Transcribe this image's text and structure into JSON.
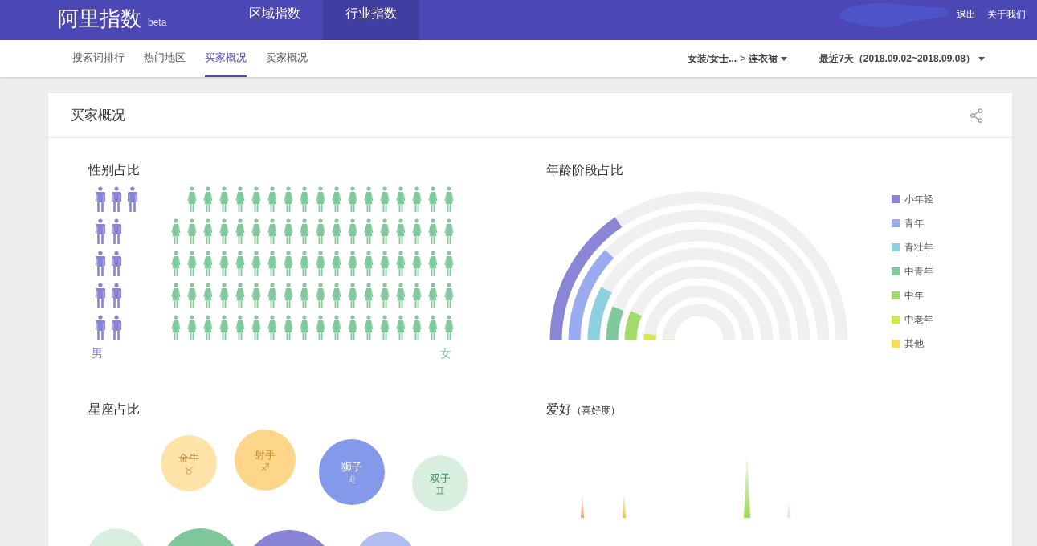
{
  "header": {
    "logo": "阿里指数",
    "badge": "beta",
    "tabs": [
      {
        "label": "区域指数",
        "selected": false
      },
      {
        "label": "行业指数",
        "selected": true
      }
    ],
    "links": [
      "退出",
      "关于我们"
    ]
  },
  "subnav": {
    "tabs": [
      {
        "label": "搜索词排行",
        "selected": false
      },
      {
        "label": "热门地区",
        "selected": false
      },
      {
        "label": "买家概况",
        "selected": true
      },
      {
        "label": "卖家概况",
        "selected": false
      }
    ],
    "category": {
      "parent": "女装/女士...",
      "separator": ">",
      "current": "连衣裙"
    },
    "date_range": "最近7天（2018.09.02~2018.09.08）"
  },
  "card": {
    "title": "买家概况",
    "gender": {
      "title": "性别占比",
      "male_label": "男",
      "female_label": "女",
      "level": 0.11
    },
    "age": {
      "title": "年龄阶段占比",
      "groups": [
        {
          "label": "小年轻",
          "color": "#8985d7"
        },
        {
          "label": "青年",
          "color": "#9aabef"
        },
        {
          "label": "青壮年",
          "color": "#8dd0df"
        },
        {
          "label": "中青年",
          "color": "#80c99c"
        },
        {
          "label": "中年",
          "color": "#a3dc6c"
        },
        {
          "label": "中老年",
          "color": "#d3e84f"
        },
        {
          "label": "其他",
          "color": "#f7dc55"
        }
      ]
    },
    "constellation": {
      "title": "星座占比",
      "bubbles": [
        {
          "label": "金牛",
          "symbol": "♉",
          "color": "#fde3a8"
        },
        {
          "label": "射手",
          "symbol": "♐",
          "color": "#fdd68a"
        },
        {
          "label": "狮子",
          "symbol": "♌",
          "color": "#8599ea"
        },
        {
          "label": "双子",
          "symbol": "♊",
          "color": "#d8eedf"
        },
        {
          "color": "#d8eedf"
        },
        {
          "color": "#80c89c"
        },
        {
          "color": "#8a84d6"
        },
        {
          "color": "#b0bdf0"
        }
      ]
    },
    "hobby": {
      "title": "爱好",
      "subtitle": "（喜好度）"
    }
  }
}
